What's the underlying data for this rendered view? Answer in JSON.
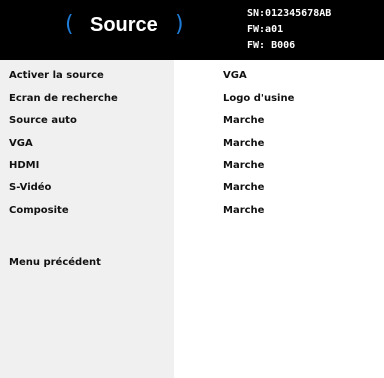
{
  "header": {
    "title": "Source",
    "paren_left": "(",
    "paren_right": ")",
    "serial": "SN:012345678AB",
    "fw1": "FW:a01",
    "fw2": "FW: B006"
  },
  "menu": {
    "items": [
      {
        "label": "Activer la source",
        "value": "VGA"
      },
      {
        "label": "Ecran de recherche",
        "value": "Logo d'usine"
      },
      {
        "label": "Source auto",
        "value": "Marche"
      },
      {
        "label": "VGA",
        "value": "Marche"
      },
      {
        "label": "HDMI",
        "value": "Marche"
      },
      {
        "label": "S-Vidéo",
        "value": "Marche"
      },
      {
        "label": "Composite",
        "value": "Marche"
      }
    ],
    "back_label": "Menu précédent"
  },
  "colors": {
    "header_bg": "#000000",
    "accent": "#1e7bd6",
    "left_panel_bg": "#f0f0f0",
    "right_panel_bg": "#ffffff"
  }
}
